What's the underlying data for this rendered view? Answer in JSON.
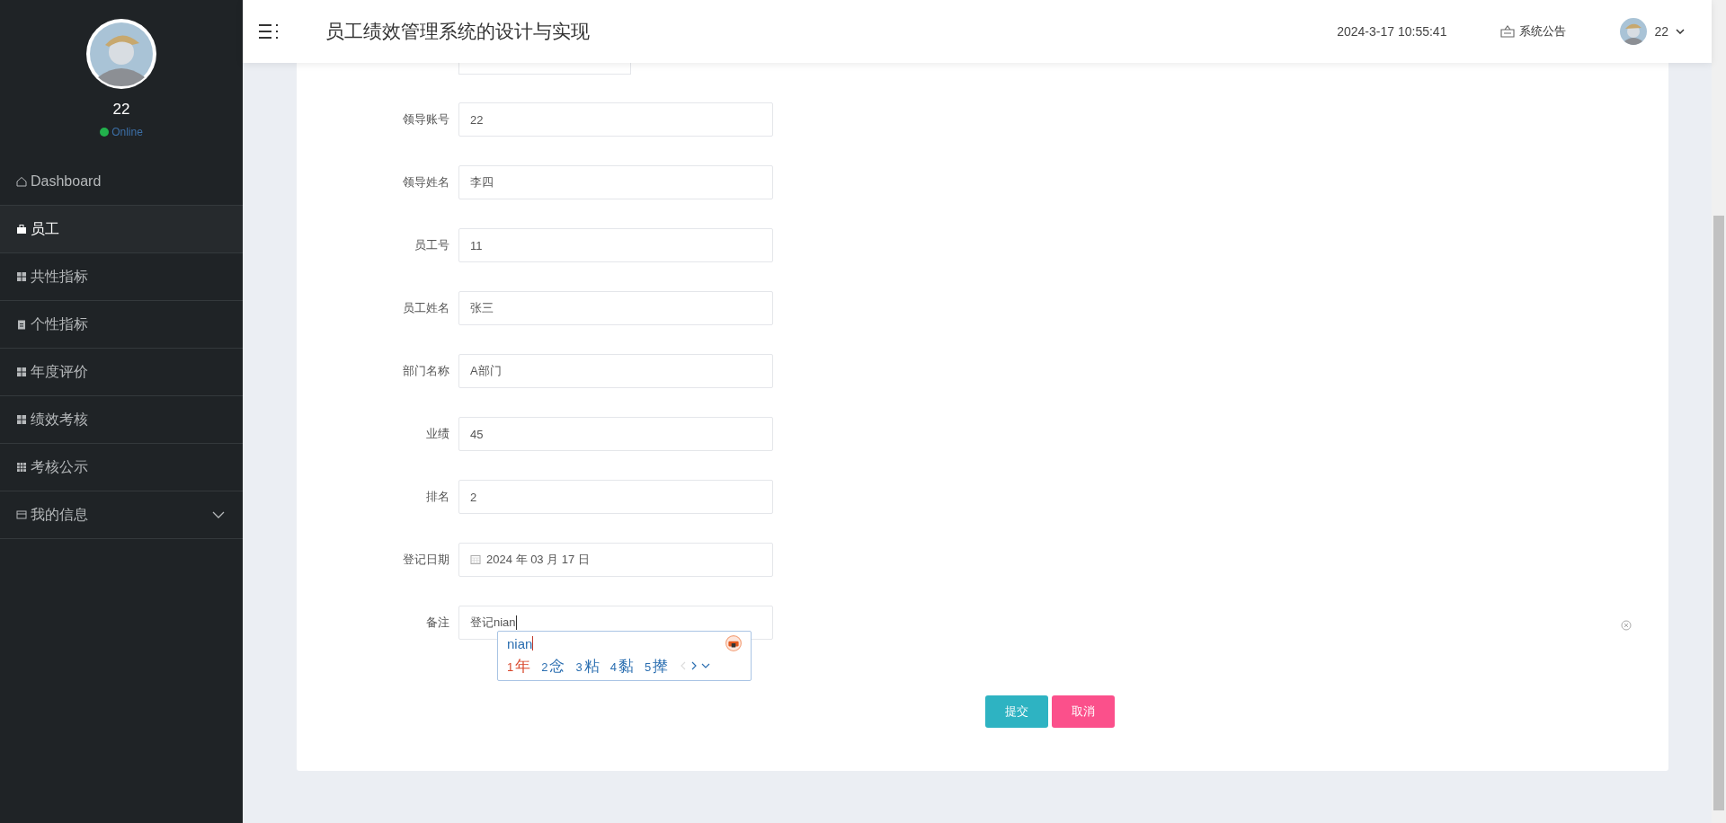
{
  "sidebar": {
    "username": "22",
    "status": "Online",
    "online": true,
    "items": [
      {
        "label": "Dashboard",
        "kind": "home",
        "selected": false
      },
      {
        "label": "员工",
        "kind": "bag",
        "selected": true
      },
      {
        "label": "共性指标",
        "kind": "grid",
        "selected": false
      },
      {
        "label": "个性指标",
        "kind": "clipboard",
        "selected": false
      },
      {
        "label": "年度评价",
        "kind": "grid",
        "selected": false
      },
      {
        "label": "绩效考核",
        "kind": "grid",
        "selected": false
      },
      {
        "label": "考核公示",
        "kind": "grid9",
        "selected": false
      },
      {
        "label": "我的信息",
        "kind": "window",
        "selected": false,
        "expandable": true
      }
    ]
  },
  "header": {
    "title": "员工绩效管理系统的设计与实现",
    "datetime": "2024-3-17 10:55:41",
    "notice": "系统公告",
    "user": "22"
  },
  "form": {
    "fields": [
      {
        "label": "领导账号",
        "value": "22",
        "kind": "text"
      },
      {
        "label": "领导姓名",
        "value": "李四",
        "kind": "text"
      },
      {
        "label": "员工号",
        "value": "11",
        "kind": "text"
      },
      {
        "label": "员工姓名",
        "value": "张三",
        "kind": "text"
      },
      {
        "label": "部门名称",
        "value": "A部门",
        "kind": "text"
      },
      {
        "label": "业绩",
        "value": "45",
        "kind": "text"
      },
      {
        "label": "排名",
        "value": "2",
        "kind": "text"
      },
      {
        "label": "登记日期",
        "value": "2024 年 03 月 17 日",
        "kind": "date"
      },
      {
        "label": "备注",
        "value": "登记nian",
        "kind": "text",
        "focused": true
      }
    ],
    "buttons": [
      {
        "label": "提交",
        "kind": "primary"
      },
      {
        "label": "取消",
        "kind": "danger"
      }
    ]
  },
  "ime": {
    "composition": "nian",
    "candidates": [
      {
        "index": "1",
        "text": "年",
        "selected": true
      },
      {
        "index": "2",
        "text": "念",
        "selected": false
      },
      {
        "index": "3",
        "text": "粘",
        "selected": false
      },
      {
        "index": "4",
        "text": "黏",
        "selected": false
      },
      {
        "index": "5",
        "text": "撵",
        "selected": false
      }
    ]
  }
}
